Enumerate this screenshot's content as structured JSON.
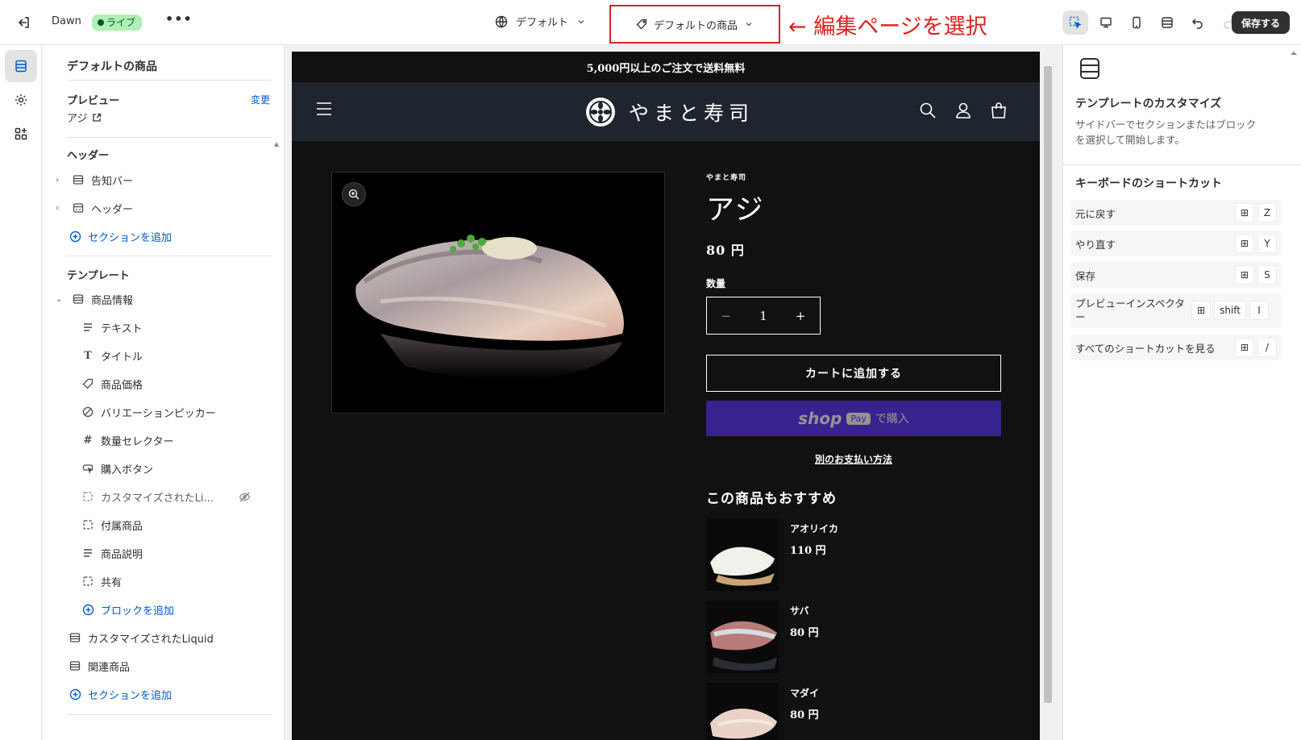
{
  "topbar": {
    "theme_name": "Dawn",
    "live_badge": "ライブ",
    "more": "•••",
    "template_label": "デフォルト",
    "page_label": "デフォルトの商品",
    "annotation": "← 編集ページを選択",
    "save_label": "保存する"
  },
  "left_panel": {
    "title": "デフォルトの商品",
    "preview_label": "プレビュー",
    "preview_change": "変更",
    "preview_value": "アジ",
    "header_group": "ヘッダー",
    "header_items": [
      "告知バー",
      "ヘッダー"
    ],
    "add_section": "セクションを追加",
    "template_group": "テンプレート",
    "product_info": "商品情報",
    "blocks": [
      "テキスト",
      "タイトル",
      "商品価格",
      "バリエーションピッカー",
      "数量セレクター",
      "購入ボタン",
      "カスタマイズされたLi...",
      "付属商品",
      "商品説明",
      "共有"
    ],
    "add_block": "ブロックを追加",
    "sections": [
      "カスタマイズされたLiquid",
      "関連商品"
    ],
    "add_section_2": "セクションを追加"
  },
  "preview": {
    "announcement": "5,000円以上のご注文で送料無料",
    "store_name": "やまと寿司",
    "vendor": "やまと寿司",
    "product_name": "アジ",
    "price": "80 円",
    "qty_label": "数量",
    "qty_minus": "−",
    "qty_value": "1",
    "qty_plus": "+",
    "add_to_cart": "カートに追加する",
    "shop_pay_brand": "shop",
    "shop_pay_badge": "Pay",
    "shop_pay_text": "で購入",
    "more_payment": "別のお支払い方法",
    "recommend_title": "この商品もおすすめ",
    "recommendations": [
      {
        "name": "アオリイカ",
        "price": "110 円"
      },
      {
        "name": "サバ",
        "price": "80 円"
      },
      {
        "name": "マダイ",
        "price": "80 円"
      }
    ]
  },
  "right_panel": {
    "title": "テンプレートのカスタマイズ",
    "description": "サイドバーでセクションまたはブロックを選択して開始します。",
    "shortcuts_title": "キーボードのショートカット",
    "shortcuts": [
      {
        "label": "元に戻す",
        "mod": "⊞",
        "key": "Z"
      },
      {
        "label": "やり直す",
        "mod": "⊞",
        "key": "Y"
      },
      {
        "label": "保存",
        "mod": "⊞",
        "key": "S"
      },
      {
        "label": "プレビューインスペクター",
        "mod": "⊞",
        "key2": "shift",
        "key": "I"
      },
      {
        "label": "すべてのショートカットを見る",
        "mod": "⊞",
        "key": "/"
      }
    ]
  }
}
